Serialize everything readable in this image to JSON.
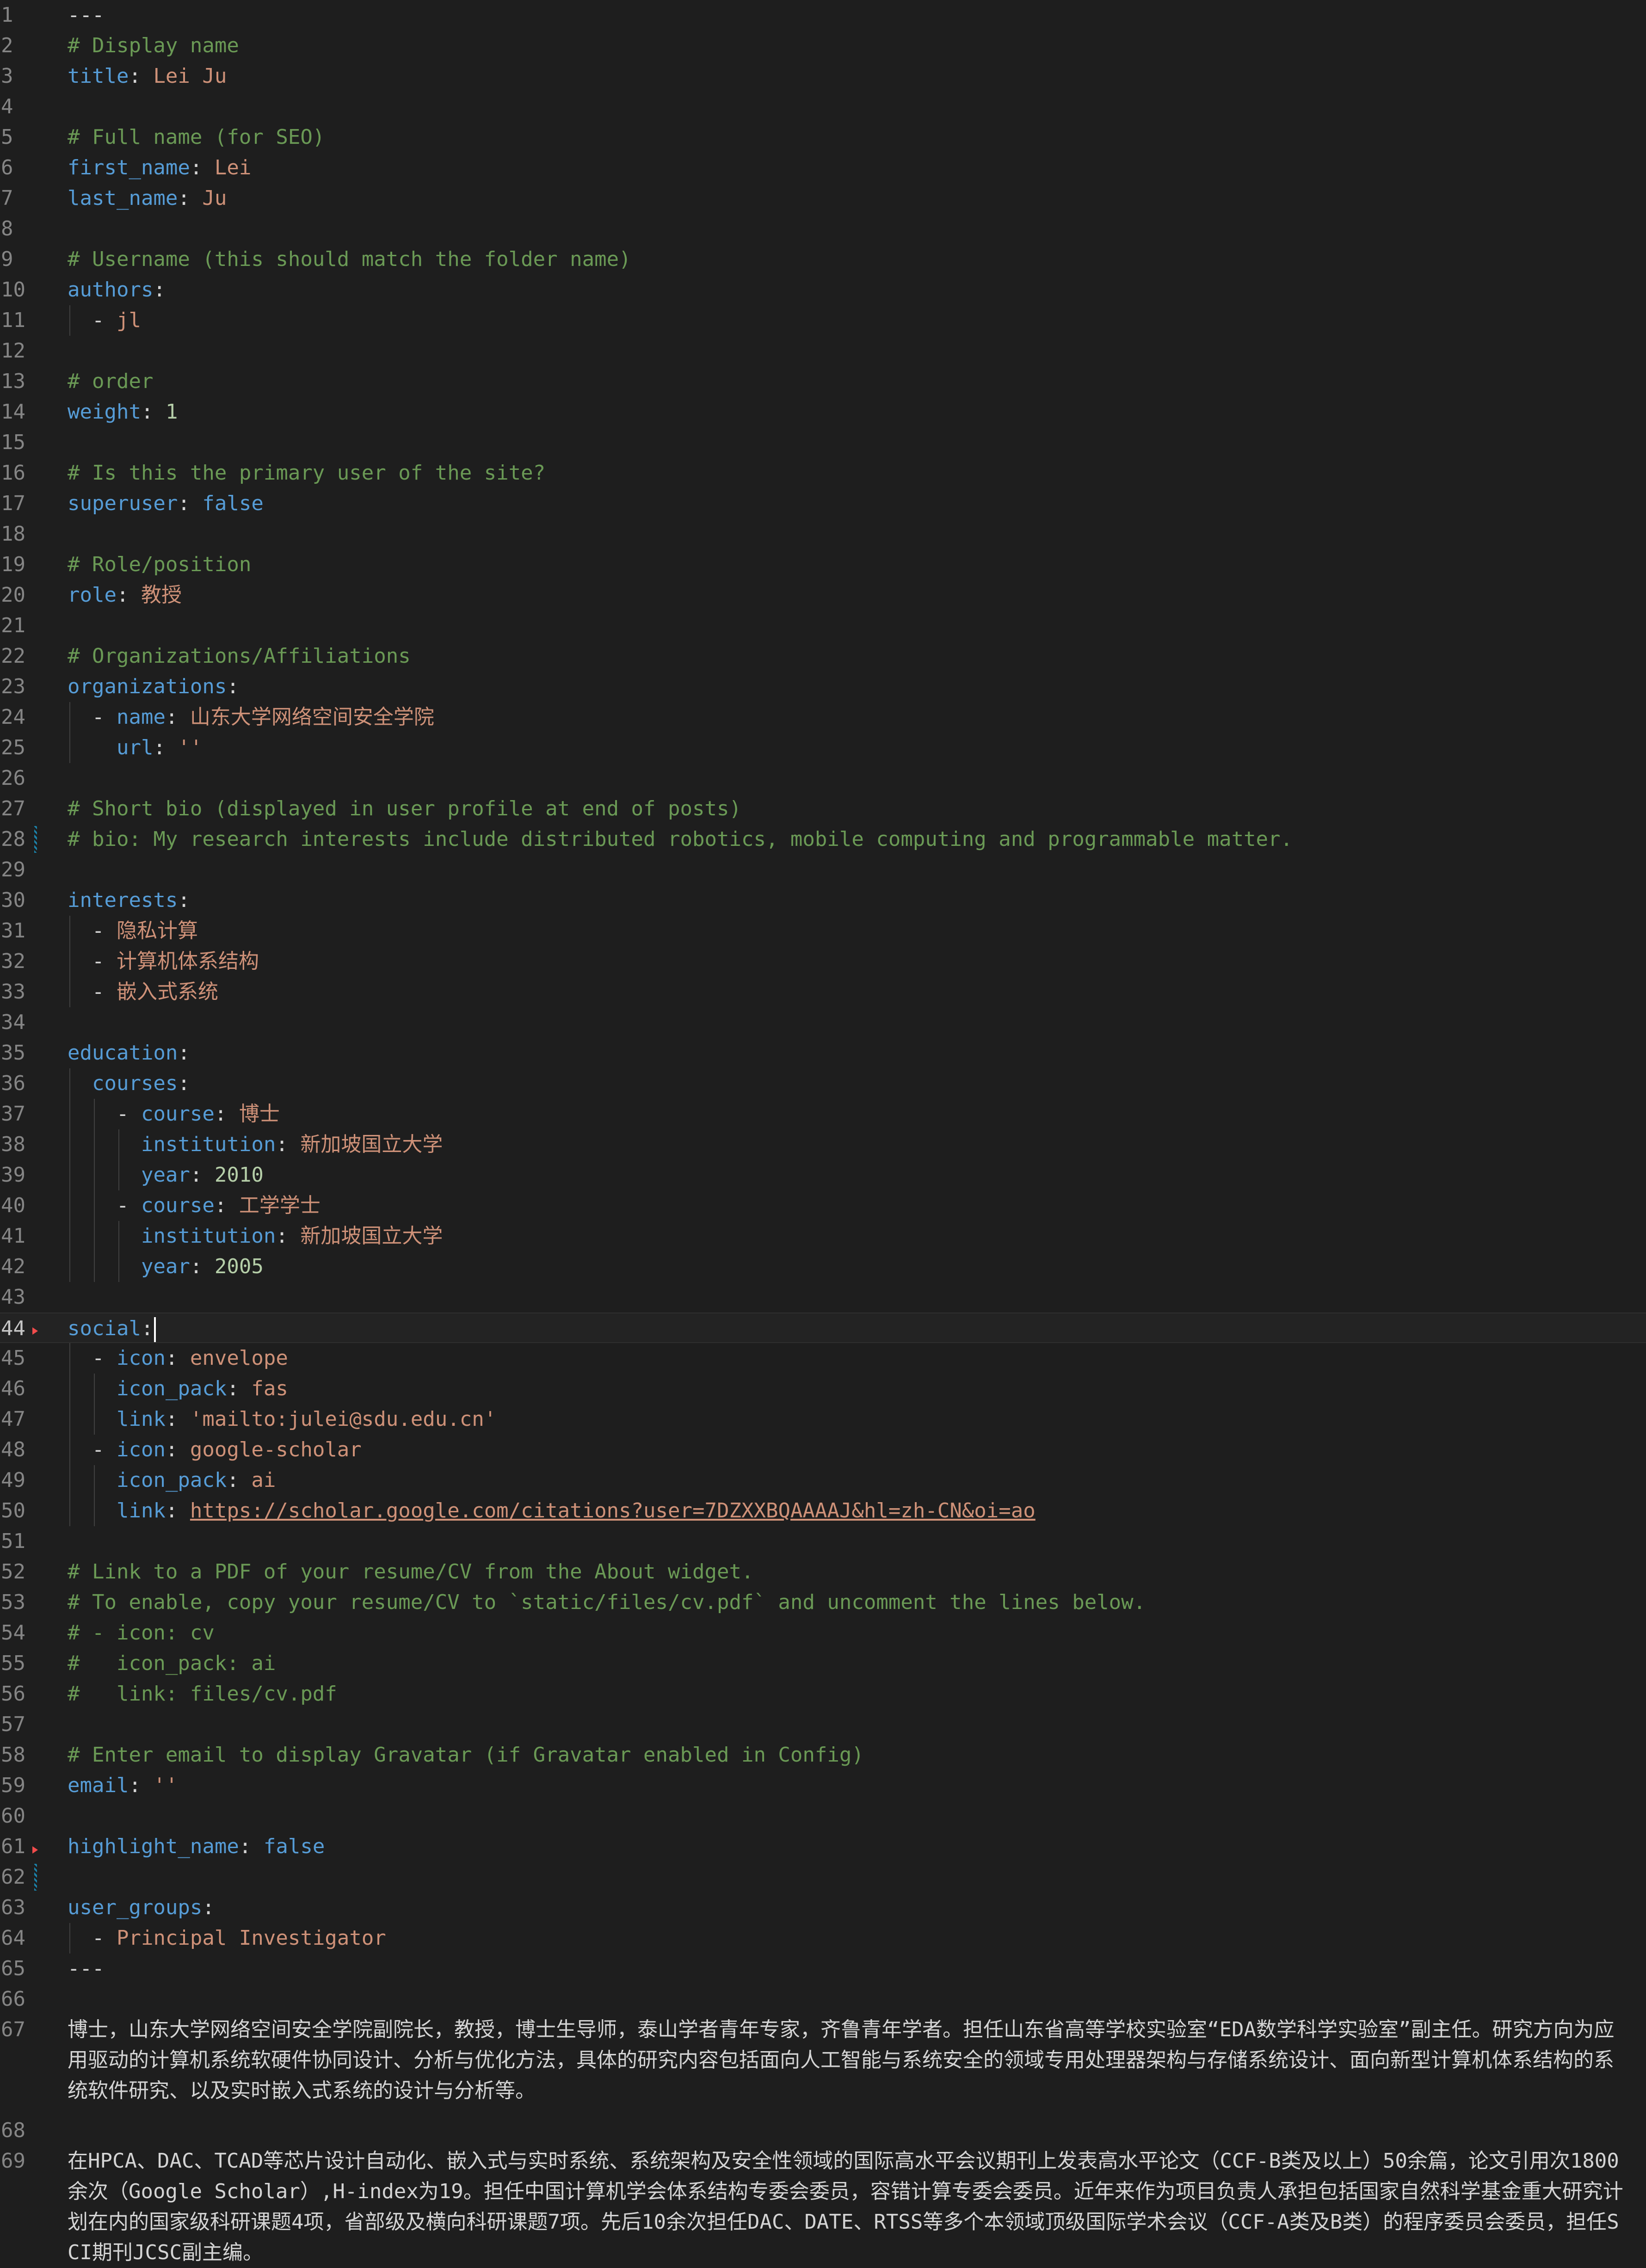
{
  "editor": {
    "active_line": 44,
    "colors": {
      "key": "#569cd6",
      "string": "#ce9178",
      "number": "#b5cea8",
      "comment": "#6a9955",
      "background": "#1e1e1e"
    },
    "lines": [
      {
        "n": "1",
        "tokens": [
          {
            "t": "---",
            "c": "p"
          }
        ]
      },
      {
        "n": "2",
        "tokens": [
          {
            "t": "# Display name",
            "c": "c"
          }
        ]
      },
      {
        "n": "3",
        "tokens": [
          {
            "t": "title",
            "c": "k"
          },
          {
            "t": ": ",
            "c": "p"
          },
          {
            "t": "Lei Ju",
            "c": "s"
          }
        ]
      },
      {
        "n": "4",
        "tokens": []
      },
      {
        "n": "5",
        "tokens": [
          {
            "t": "# Full name (for SEO)",
            "c": "c"
          }
        ]
      },
      {
        "n": "6",
        "tokens": [
          {
            "t": "first_name",
            "c": "k"
          },
          {
            "t": ": ",
            "c": "p"
          },
          {
            "t": "Lei",
            "c": "s"
          }
        ]
      },
      {
        "n": "7",
        "tokens": [
          {
            "t": "last_name",
            "c": "k"
          },
          {
            "t": ": ",
            "c": "p"
          },
          {
            "t": "Ju",
            "c": "s"
          }
        ]
      },
      {
        "n": "8",
        "tokens": []
      },
      {
        "n": "9",
        "tokens": [
          {
            "t": "# Username (this should match the folder name)",
            "c": "c"
          }
        ]
      },
      {
        "n": "10",
        "tokens": [
          {
            "t": "authors",
            "c": "k"
          },
          {
            "t": ":",
            "c": "p"
          }
        ]
      },
      {
        "n": "11",
        "tokens": [
          {
            "t": "  - ",
            "c": "p"
          },
          {
            "t": "jl",
            "c": "s"
          }
        ]
      },
      {
        "n": "12",
        "tokens": []
      },
      {
        "n": "13",
        "tokens": [
          {
            "t": "# order",
            "c": "c"
          }
        ]
      },
      {
        "n": "14",
        "tokens": [
          {
            "t": "weight",
            "c": "k"
          },
          {
            "t": ": ",
            "c": "p"
          },
          {
            "t": "1",
            "c": "n"
          }
        ]
      },
      {
        "n": "15",
        "tokens": []
      },
      {
        "n": "16",
        "tokens": [
          {
            "t": "# Is this the primary user of the site?",
            "c": "c"
          }
        ]
      },
      {
        "n": "17",
        "tokens": [
          {
            "t": "superuser",
            "c": "k"
          },
          {
            "t": ": ",
            "c": "p"
          },
          {
            "t": "false",
            "c": "b"
          }
        ]
      },
      {
        "n": "18",
        "tokens": []
      },
      {
        "n": "19",
        "tokens": [
          {
            "t": "# Role/position",
            "c": "c"
          }
        ]
      },
      {
        "n": "20",
        "tokens": [
          {
            "t": "role",
            "c": "k"
          },
          {
            "t": ": ",
            "c": "p"
          },
          {
            "t": "教授",
            "c": "s"
          }
        ]
      },
      {
        "n": "21",
        "tokens": []
      },
      {
        "n": "22",
        "tokens": [
          {
            "t": "# Organizations/Affiliations",
            "c": "c"
          }
        ]
      },
      {
        "n": "23",
        "tokens": [
          {
            "t": "organizations",
            "c": "k"
          },
          {
            "t": ":",
            "c": "p"
          }
        ]
      },
      {
        "n": "24",
        "tokens": [
          {
            "t": "  - ",
            "c": "p"
          },
          {
            "t": "name",
            "c": "k"
          },
          {
            "t": ": ",
            "c": "p"
          },
          {
            "t": "山东大学网络空间安全学院",
            "c": "s"
          }
        ]
      },
      {
        "n": "25",
        "tokens": [
          {
            "t": "    ",
            "c": "p"
          },
          {
            "t": "url",
            "c": "k"
          },
          {
            "t": ": ",
            "c": "p"
          },
          {
            "t": "''",
            "c": "s"
          }
        ]
      },
      {
        "n": "26",
        "tokens": []
      },
      {
        "n": "27",
        "tokens": [
          {
            "t": "# Short bio (displayed in user profile at end of posts)",
            "c": "c"
          }
        ]
      },
      {
        "n": "28",
        "tokens": [
          {
            "t": "# bio: My research interests include distributed robotics, mobile computing and programmable matter.",
            "c": "c"
          }
        ]
      },
      {
        "n": "29",
        "tokens": []
      },
      {
        "n": "30",
        "tokens": [
          {
            "t": "interests",
            "c": "k"
          },
          {
            "t": ":",
            "c": "p"
          }
        ]
      },
      {
        "n": "31",
        "tokens": [
          {
            "t": "  - ",
            "c": "p"
          },
          {
            "t": "隐私计算",
            "c": "s"
          }
        ]
      },
      {
        "n": "32",
        "tokens": [
          {
            "t": "  - ",
            "c": "p"
          },
          {
            "t": "计算机体系结构",
            "c": "s"
          }
        ]
      },
      {
        "n": "33",
        "tokens": [
          {
            "t": "  - ",
            "c": "p"
          },
          {
            "t": "嵌入式系统",
            "c": "s"
          }
        ]
      },
      {
        "n": "34",
        "tokens": []
      },
      {
        "n": "35",
        "tokens": [
          {
            "t": "education",
            "c": "k"
          },
          {
            "t": ":",
            "c": "p"
          }
        ]
      },
      {
        "n": "36",
        "tokens": [
          {
            "t": "  ",
            "c": "p"
          },
          {
            "t": "courses",
            "c": "k"
          },
          {
            "t": ":",
            "c": "p"
          }
        ]
      },
      {
        "n": "37",
        "tokens": [
          {
            "t": "    - ",
            "c": "p"
          },
          {
            "t": "course",
            "c": "k"
          },
          {
            "t": ": ",
            "c": "p"
          },
          {
            "t": "博士",
            "c": "s"
          }
        ]
      },
      {
        "n": "38",
        "tokens": [
          {
            "t": "      ",
            "c": "p"
          },
          {
            "t": "institution",
            "c": "k"
          },
          {
            "t": ": ",
            "c": "p"
          },
          {
            "t": "新加坡国立大学",
            "c": "s"
          }
        ]
      },
      {
        "n": "39",
        "tokens": [
          {
            "t": "      ",
            "c": "p"
          },
          {
            "t": "year",
            "c": "k"
          },
          {
            "t": ": ",
            "c": "p"
          },
          {
            "t": "2010",
            "c": "n"
          }
        ]
      },
      {
        "n": "40",
        "tokens": [
          {
            "t": "    - ",
            "c": "p"
          },
          {
            "t": "course",
            "c": "k"
          },
          {
            "t": ": ",
            "c": "p"
          },
          {
            "t": "工学学士",
            "c": "s"
          }
        ]
      },
      {
        "n": "41",
        "tokens": [
          {
            "t": "      ",
            "c": "p"
          },
          {
            "t": "institution",
            "c": "k"
          },
          {
            "t": ": ",
            "c": "p"
          },
          {
            "t": "新加坡国立大学",
            "c": "s"
          }
        ]
      },
      {
        "n": "42",
        "tokens": [
          {
            "t": "      ",
            "c": "p"
          },
          {
            "t": "year",
            "c": "k"
          },
          {
            "t": ": ",
            "c": "p"
          },
          {
            "t": "2005",
            "c": "n"
          }
        ]
      },
      {
        "n": "43",
        "tokens": []
      },
      {
        "n": "44",
        "tokens": [
          {
            "t": "social",
            "c": "k"
          },
          {
            "t": ":",
            "c": "p"
          }
        ]
      },
      {
        "n": "45",
        "tokens": [
          {
            "t": "  - ",
            "c": "p"
          },
          {
            "t": "icon",
            "c": "k"
          },
          {
            "t": ": ",
            "c": "p"
          },
          {
            "t": "envelope",
            "c": "s"
          }
        ]
      },
      {
        "n": "46",
        "tokens": [
          {
            "t": "    ",
            "c": "p"
          },
          {
            "t": "icon_pack",
            "c": "k"
          },
          {
            "t": ": ",
            "c": "p"
          },
          {
            "t": "fas",
            "c": "s"
          }
        ]
      },
      {
        "n": "47",
        "tokens": [
          {
            "t": "    ",
            "c": "p"
          },
          {
            "t": "link",
            "c": "k"
          },
          {
            "t": ": ",
            "c": "p"
          },
          {
            "t": "'mailto:julei@sdu.edu.cn'",
            "c": "s"
          }
        ]
      },
      {
        "n": "48",
        "tokens": [
          {
            "t": "  - ",
            "c": "p"
          },
          {
            "t": "icon",
            "c": "k"
          },
          {
            "t": ": ",
            "c": "p"
          },
          {
            "t": "google-scholar",
            "c": "s"
          }
        ]
      },
      {
        "n": "49",
        "tokens": [
          {
            "t": "    ",
            "c": "p"
          },
          {
            "t": "icon_pack",
            "c": "k"
          },
          {
            "t": ": ",
            "c": "p"
          },
          {
            "t": "ai",
            "c": "s"
          }
        ]
      },
      {
        "n": "50",
        "tokens": [
          {
            "t": "    ",
            "c": "p"
          },
          {
            "t": "link",
            "c": "k"
          },
          {
            "t": ": ",
            "c": "p"
          },
          {
            "t": "https://scholar.google.com/citations?user=7DZXXBQAAAAJ&hl=zh-CN&oi=ao",
            "c": "u"
          }
        ]
      },
      {
        "n": "51",
        "tokens": []
      },
      {
        "n": "52",
        "tokens": [
          {
            "t": "# Link to a PDF of your resume/CV from the About widget.",
            "c": "c"
          }
        ]
      },
      {
        "n": "53",
        "tokens": [
          {
            "t": "# To enable, copy your resume/CV to `static/files/cv.pdf` and uncomment the lines below.",
            "c": "c"
          }
        ]
      },
      {
        "n": "54",
        "tokens": [
          {
            "t": "# - icon: cv",
            "c": "c"
          }
        ]
      },
      {
        "n": "55",
        "tokens": [
          {
            "t": "#   icon_pack: ai",
            "c": "c"
          }
        ]
      },
      {
        "n": "56",
        "tokens": [
          {
            "t": "#   link: files/cv.pdf",
            "c": "c"
          }
        ]
      },
      {
        "n": "57",
        "tokens": []
      },
      {
        "n": "58",
        "tokens": [
          {
            "t": "# Enter email to display Gravatar (if Gravatar enabled in Config)",
            "c": "c"
          }
        ]
      },
      {
        "n": "59",
        "tokens": [
          {
            "t": "email",
            "c": "k"
          },
          {
            "t": ": ",
            "c": "p"
          },
          {
            "t": "''",
            "c": "s"
          }
        ]
      },
      {
        "n": "60",
        "tokens": []
      },
      {
        "n": "61",
        "tokens": [
          {
            "t": "highlight_name",
            "c": "k"
          },
          {
            "t": ": ",
            "c": "p"
          },
          {
            "t": "false",
            "c": "b"
          }
        ]
      },
      {
        "n": "62",
        "tokens": []
      },
      {
        "n": "63",
        "tokens": [
          {
            "t": "user_groups",
            "c": "k"
          },
          {
            "t": ":",
            "c": "p"
          }
        ]
      },
      {
        "n": "64",
        "tokens": [
          {
            "t": "  - ",
            "c": "p"
          },
          {
            "t": "Principal Investigator",
            "c": "s"
          }
        ]
      },
      {
        "n": "65",
        "tokens": [
          {
            "t": "---",
            "c": "p"
          }
        ]
      },
      {
        "n": "66",
        "tokens": []
      }
    ],
    "paragraphs": [
      {
        "n": "67",
        "text": "博士，山东大学网络空间安全学院副院长，教授，博士生导师，泰山学者青年专家，齐鲁青年学者。担任山东省高等学校实验室“EDA数学科学实验室”副主任。研究方向为应用驱动的计算机系统软硬件协同设计、分析与优化方法，具体的研究内容包括面向人工智能与系统安全的领域专用处理器架构与存储系统设计、面向新型计算机体系结构的系统软件研究、以及实时嵌入式系统的设计与分析等。"
      },
      {
        "n": "68",
        "text": ""
      },
      {
        "n": "69",
        "text": "在HPCA、DAC、TCAD等芯片设计自动化、嵌入式与实时系统、系统架构及安全性领域的国际高水平会议期刊上发表高水平论文（CCF-B类及以上）50余篇，论文引用次1800余次（Google Scholar）,H-index为19。担任中国计算机学会体系结构专委会委员，容错计算专委会委员。近年来作为项目负责人承担包括国家自然科学基金重大研究计划在内的国家级科研课题4项，省部级及横向科研课题7项。先后10余次担任DAC、DATE、RTSS等多个本领域顶级国际学术会议（CCF-A类及B类）的程序委员会委员，担任SCI期刊JCSC副主编。"
      }
    ]
  }
}
